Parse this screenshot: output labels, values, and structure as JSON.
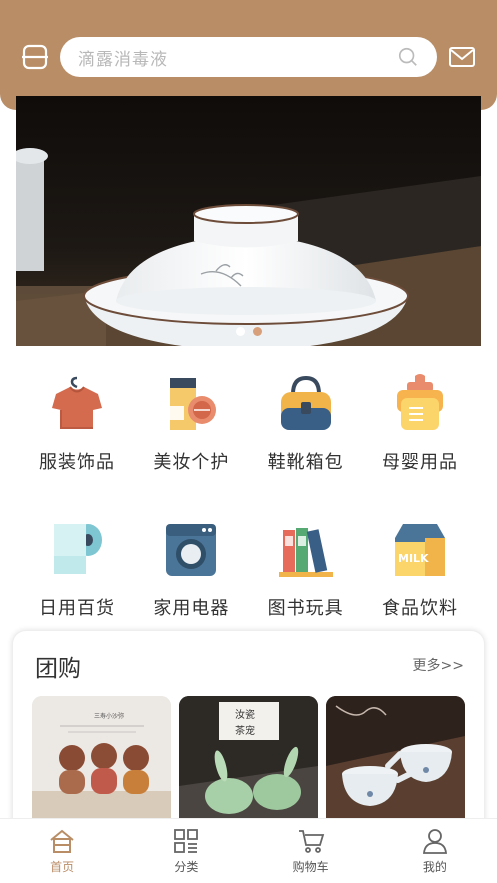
{
  "search": {
    "placeholder": "滴露消毒液"
  },
  "banner": {
    "slides": 2,
    "active_index": 0
  },
  "categories": [
    {
      "label": "服装饰品",
      "icon": "clothing-icon"
    },
    {
      "label": "美妆个护",
      "icon": "cosmetics-icon"
    },
    {
      "label": "鞋靴箱包",
      "icon": "bag-icon"
    },
    {
      "label": "母婴用品",
      "icon": "baby-bottle-icon"
    },
    {
      "label": "日用百货",
      "icon": "tissue-roll-icon"
    },
    {
      "label": "家用电器",
      "icon": "washing-machine-icon"
    },
    {
      "label": "图书玩具",
      "icon": "books-icon"
    },
    {
      "label": "食品饮料",
      "icon": "milk-carton-icon"
    }
  ],
  "group": {
    "title": "团购",
    "more": "更多>>",
    "items": [
      {
        "caption": "三寿小沙弥"
      },
      {
        "caption": "汝瓷茶宠"
      },
      {
        "caption": ""
      }
    ],
    "item2_stamp": "汝瓷\n茶宠",
    "item1_stamp": "三寿小沙弥"
  },
  "tabs": [
    {
      "label": "首页",
      "active": true
    },
    {
      "label": "分类",
      "active": false
    },
    {
      "label": "购物车",
      "active": false
    },
    {
      "label": "我的",
      "active": false
    }
  ],
  "colors": {
    "accent": "#b98d66"
  }
}
